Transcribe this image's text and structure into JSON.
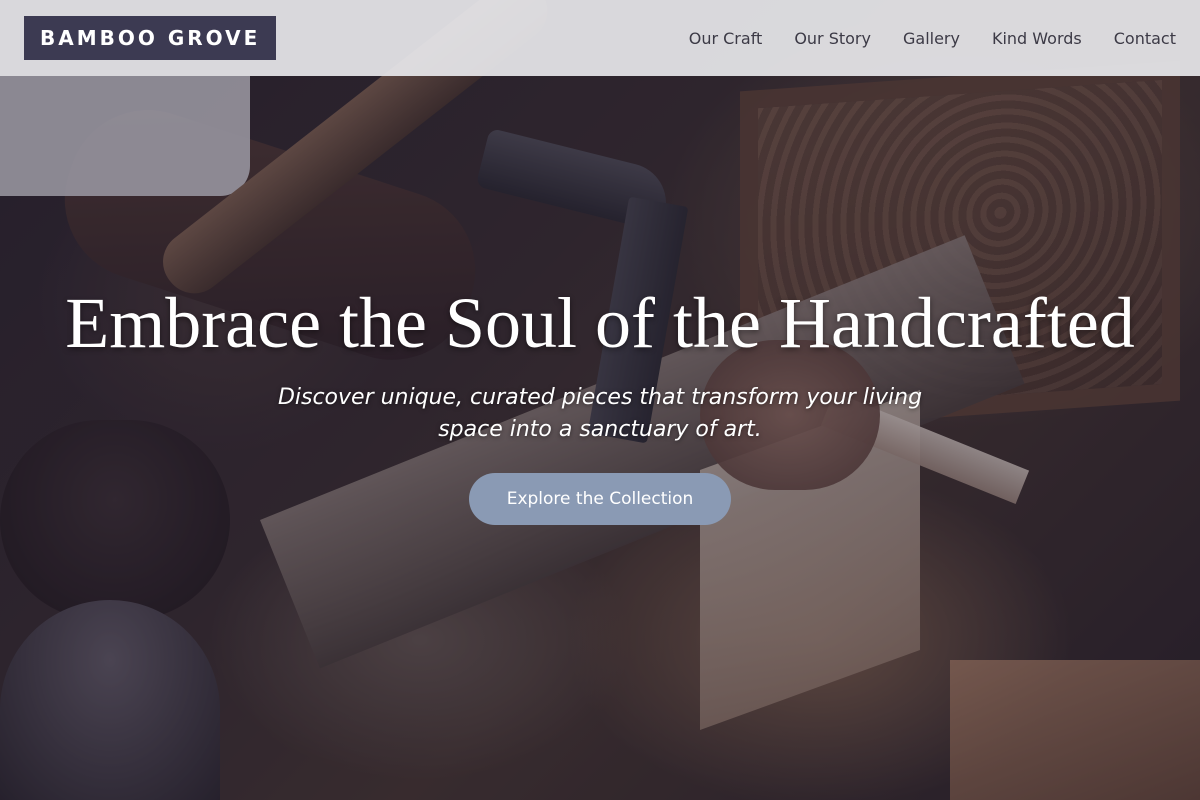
{
  "header": {
    "logo": "BAMBOO GROVE",
    "nav": [
      "Our Craft",
      "Our Story",
      "Gallery",
      "Kind Words",
      "Contact"
    ]
  },
  "hero": {
    "title": "Embrace the Soul of the Handcrafted",
    "subtitle": "Discover unique, curated pieces that transform your living space into a sanctuary of art.",
    "cta": "Explore the Collection",
    "background_image": "woodworker-carving-wood-photo"
  },
  "colors": {
    "logo_bg": "#3c3a52",
    "header_bg": "#e8e8ec",
    "nav_text": "#3c3a46",
    "cta_bg": "#8a9ab4",
    "text_light": "#ffffff"
  }
}
